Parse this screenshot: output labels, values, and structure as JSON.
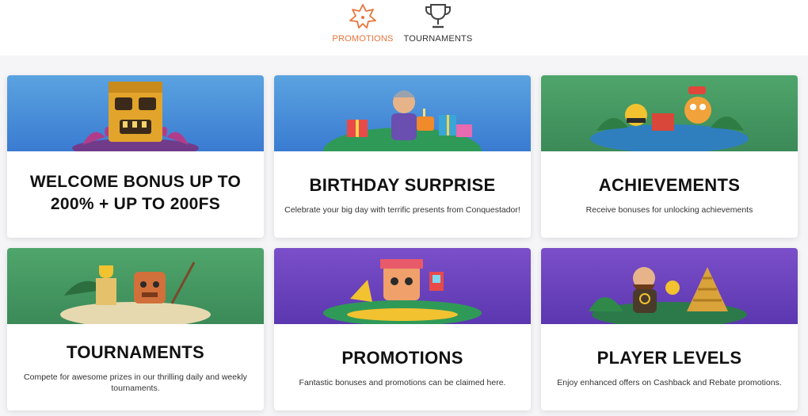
{
  "nav": {
    "tabs": [
      {
        "label": "PROMOTIONS",
        "icon": "promotions-star-icon",
        "active": true
      },
      {
        "label": "TOURNAMENTS",
        "icon": "trophy-icon",
        "active": false
      }
    ]
  },
  "colors": {
    "accent": "#e8743b",
    "text_dark": "#111111",
    "banner_blue": "#4a8fd9",
    "banner_green": "#469a62",
    "banner_purple": "#6a43bd"
  },
  "cards": [
    {
      "title": "WELCOME BONUS UP TO 200% + UP TO 200FS",
      "description": "",
      "banner": "blue"
    },
    {
      "title": "BIRTHDAY SURPRISE",
      "description": "Celebrate your big day with terrific presents from Conquestador!",
      "banner": "blue"
    },
    {
      "title": "ACHIEVEMENTS",
      "description": "Receive bonuses for unlocking achievements",
      "banner": "green"
    },
    {
      "title": "TOURNAMENTS",
      "description": "Compete for awesome prizes in our thrilling daily and weekly tournaments.",
      "banner": "green"
    },
    {
      "title": "PROMOTIONS",
      "description": "Fantastic bonuses and promotions can be claimed here.",
      "banner": "purple"
    },
    {
      "title": "PLAYER LEVELS",
      "description": "Enjoy enhanced offers on Cashback and Rebate promotions.",
      "banner": "purple"
    }
  ]
}
